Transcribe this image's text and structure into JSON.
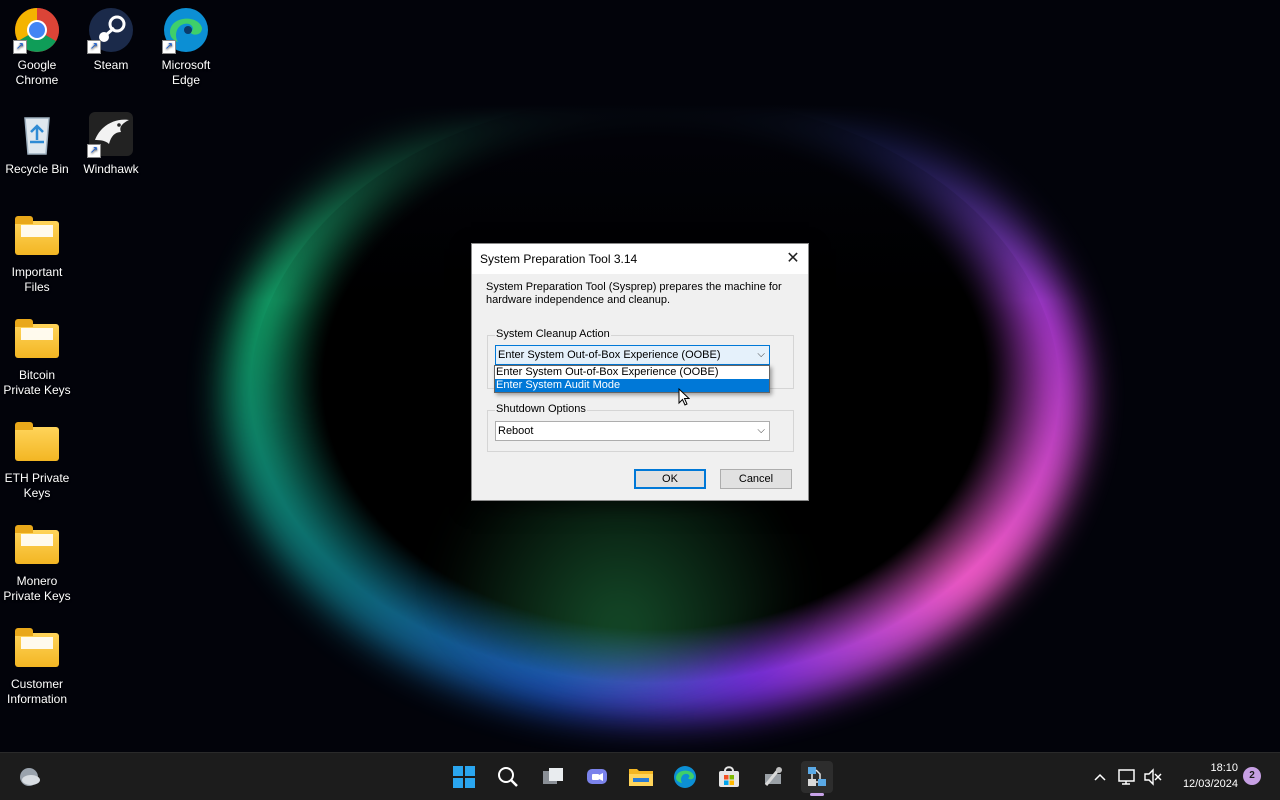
{
  "desktop": {
    "icons": [
      {
        "label": "Google Chrome",
        "icon": "chrome-icon"
      },
      {
        "label": "Steam",
        "icon": "steam-icon"
      },
      {
        "label": "Microsoft Edge",
        "icon": "edge-icon"
      },
      {
        "label": "Recycle Bin",
        "icon": "recycle-bin-icon"
      },
      {
        "label": "Windhawk",
        "icon": "windhawk-icon"
      },
      {
        "label": "Important Files",
        "icon": "folder-icon"
      },
      {
        "label": "Bitcoin Private Keys",
        "icon": "folder-icon"
      },
      {
        "label": "ETH Private Keys",
        "icon": "folder-icon"
      },
      {
        "label": "Monero Private Keys",
        "icon": "folder-icon"
      },
      {
        "label": "Customer Information",
        "icon": "folder-icon"
      }
    ]
  },
  "dialog": {
    "title": "System Preparation Tool 3.14",
    "close": "✕",
    "description": "System Preparation Tool (Sysprep) prepares the machine for hardware independence and cleanup.",
    "cleanup_group_label": "System Cleanup Action",
    "cleanup_value": "Enter System Out-of-Box Experience (OOBE)",
    "cleanup_options": [
      "Enter System Out-of-Box Experience (OOBE)",
      "Enter System Audit Mode"
    ],
    "highlighted_option": "Enter System Audit Mode",
    "shutdown_group_label": "Shutdown Options",
    "shutdown_value": "Reboot",
    "ok_label": "OK",
    "cancel_label": "Cancel",
    "accent_color": "#0078d7"
  },
  "taskbar": {
    "icons": [
      "weather-icon",
      "start-icon",
      "search-icon",
      "task-view-icon",
      "teams-chat-icon",
      "file-explorer-icon",
      "edge-icon",
      "store-icon",
      "tools-icon",
      "sysprep-icon"
    ],
    "time": "18:10",
    "date": "12/03/2024",
    "notification_count": "2"
  }
}
